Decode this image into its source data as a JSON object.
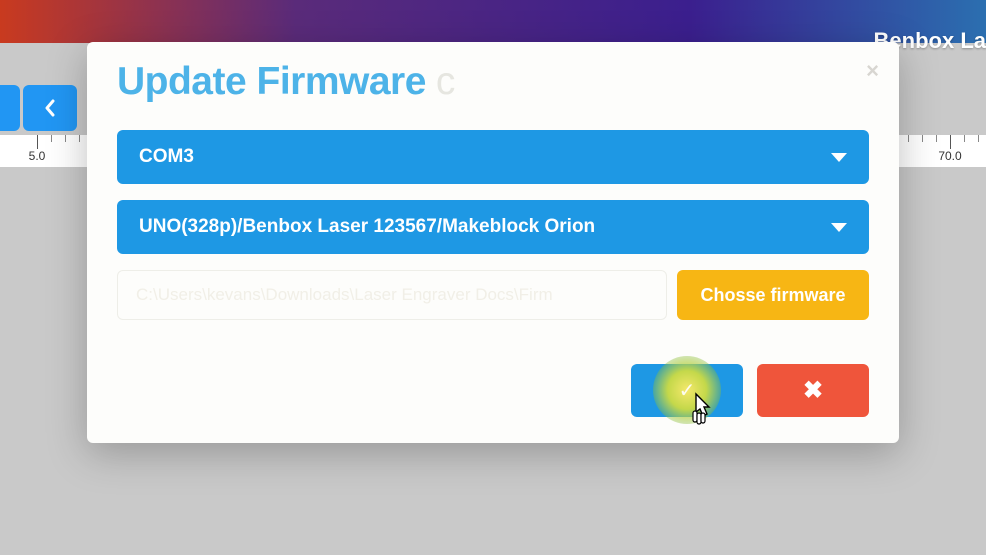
{
  "background": {
    "brand_label": "Benbox La",
    "ruler_ticks": [
      "5.0",
      "70.0"
    ]
  },
  "modal": {
    "title": "Update Firmware",
    "close_glyph": "×",
    "port_select": {
      "value": "COM3"
    },
    "board_select": {
      "value": "UNO(328p)/Benbox Laser 123567/Makeblock Orion"
    },
    "file_path": "C:\\Users\\kevans\\Downloads\\Laser Engraver Docs\\Firm",
    "choose_button": "Chosse firmware",
    "confirm_glyph": "✓",
    "cancel_glyph": "✖"
  }
}
